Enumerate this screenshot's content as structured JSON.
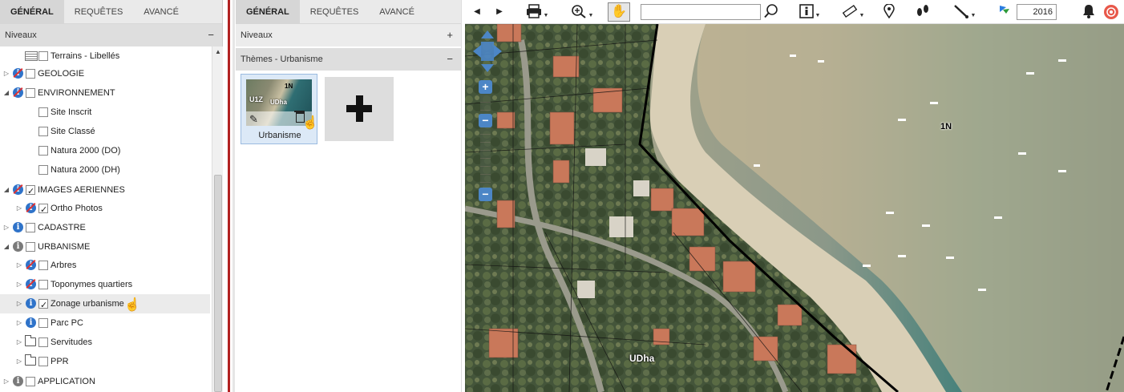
{
  "left_panel": {
    "tabs": [
      {
        "label": "GÉNÉRAL",
        "active": true
      },
      {
        "label": "REQUÊTES",
        "active": false
      },
      {
        "label": "AVANCÉ",
        "active": false
      }
    ],
    "section": {
      "title": "Niveaux",
      "sign": "−"
    },
    "tree": [
      {
        "label": "Terrains - Libellés",
        "icon": "legend-icon",
        "checked": false
      },
      {
        "label": "GEOLOGIE",
        "icon": "no-info-icon",
        "checked": false,
        "expanded": false
      },
      {
        "label": "ENVIRONNEMENT",
        "icon": "no-info-icon",
        "checked": false,
        "expanded": true
      },
      {
        "label": "Site Inscrit",
        "checked": false
      },
      {
        "label": "Site Classé",
        "checked": false
      },
      {
        "label": "Natura 2000 (DO)",
        "checked": false
      },
      {
        "label": "Natura 2000 (DH)",
        "checked": false
      },
      {
        "label": "IMAGES AERIENNES",
        "icon": "no-info-icon",
        "checked": true,
        "expanded": true
      },
      {
        "label": "Ortho Photos",
        "icon": "no-info-icon",
        "checked": true
      },
      {
        "label": "CADASTRE",
        "icon": "info-icon",
        "checked": false
      },
      {
        "label": "URBANISME",
        "icon": "info-grey-icon",
        "checked": false,
        "expanded": true
      },
      {
        "label": "Arbres",
        "icon": "no-info-icon",
        "checked": false
      },
      {
        "label": "Toponymes quartiers",
        "icon": "no-info-icon",
        "checked": false
      },
      {
        "label": "Zonage urbanisme",
        "icon": "info-icon",
        "checked": true
      },
      {
        "label": "Parc PC",
        "icon": "info-icon",
        "checked": false
      },
      {
        "label": "Servitudes",
        "icon": "folder-icon",
        "checked": false
      },
      {
        "label": "PPR",
        "icon": "folder-icon",
        "checked": false
      },
      {
        "label": "APPLICATION",
        "icon": "info-grey-icon",
        "checked": false
      }
    ]
  },
  "middle_panel": {
    "tabs": [
      {
        "label": "GÉNÉRAL",
        "active": true
      },
      {
        "label": "REQUÊTES",
        "active": false
      },
      {
        "label": "AVANCÉ",
        "active": false
      }
    ],
    "levels": {
      "title": "Niveaux",
      "sign": "+"
    },
    "themes": {
      "title": "Thèmes - Urbanisme",
      "sign": "−"
    },
    "theme_card": {
      "name": "Urbanisme",
      "thumb_labels": [
        "1N",
        "UDha",
        "U1Z"
      ]
    }
  },
  "map": {
    "toolbar": {
      "search_value": "",
      "year": "2016"
    },
    "labels": [
      "1N",
      "UDha"
    ],
    "zoom_in": "+",
    "zoom_out": "−"
  }
}
